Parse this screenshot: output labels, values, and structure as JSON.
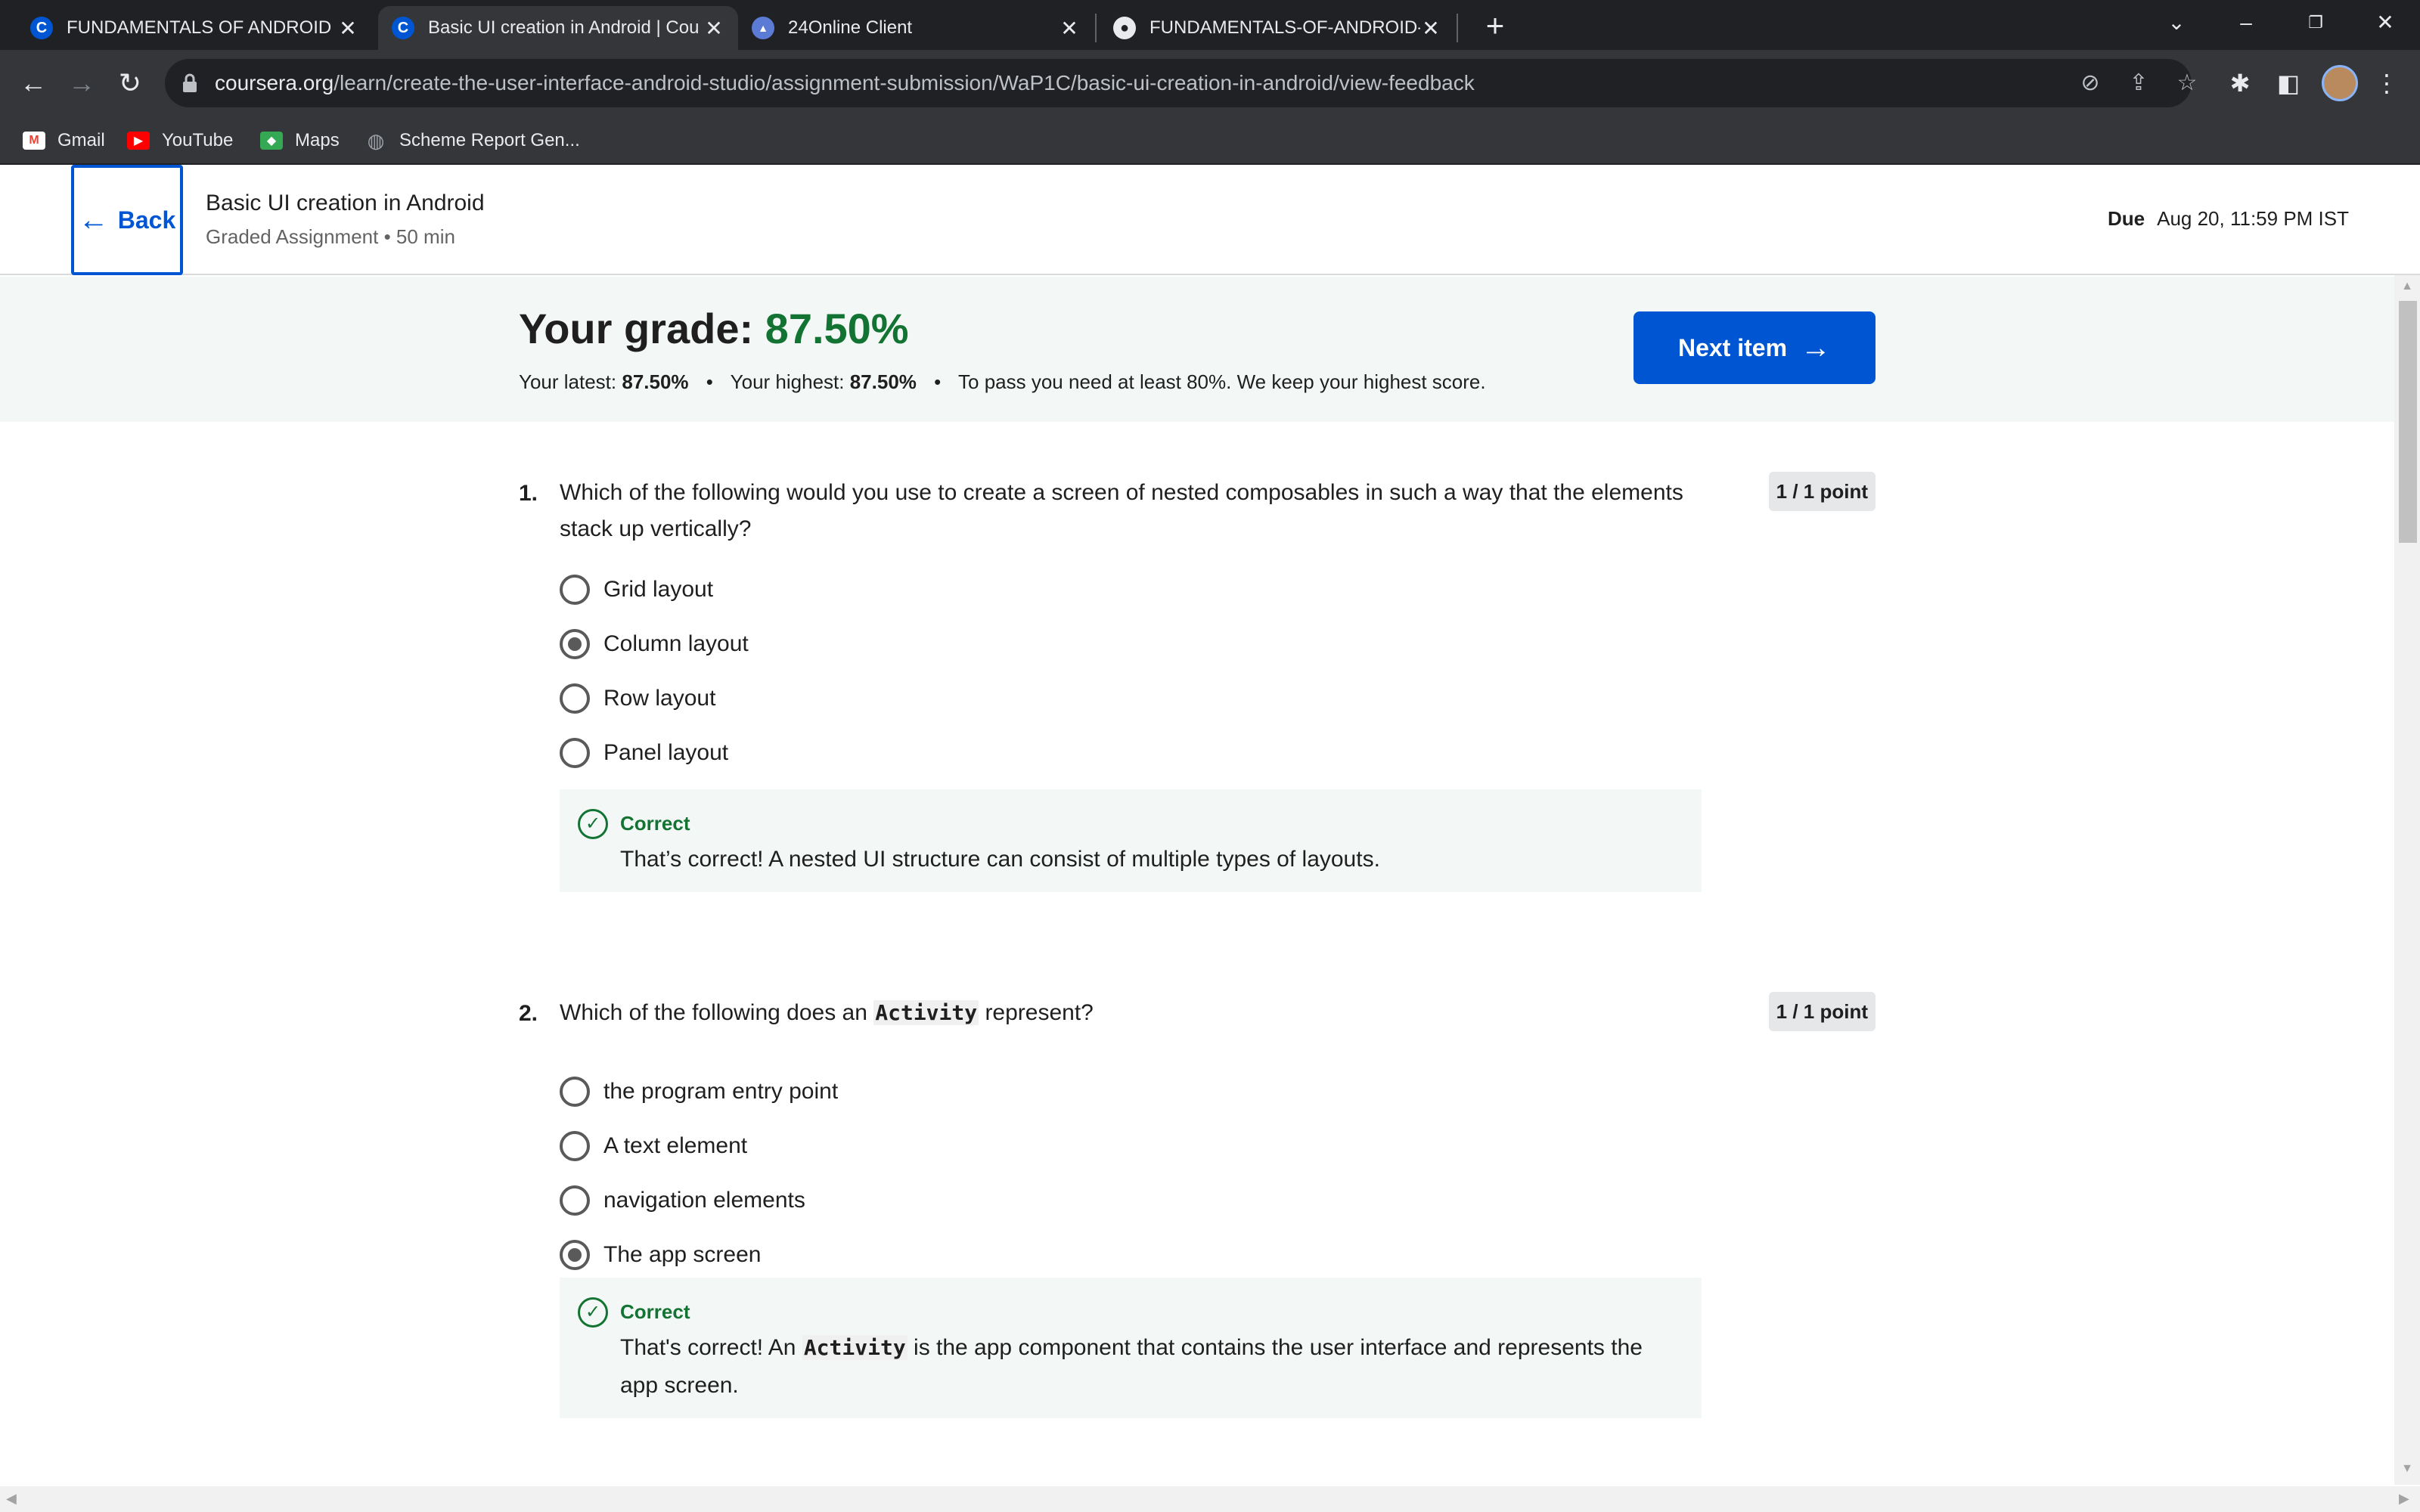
{
  "browser": {
    "tabs": [
      {
        "title": "FUNDAMENTALS OF ANDROID ::",
        "close": "✕"
      },
      {
        "title": "Basic UI creation in Android | Cou",
        "close": "✕"
      },
      {
        "title": "24Online Client",
        "close": "✕"
      },
      {
        "title": "FUNDAMENTALS-OF-ANDROID-",
        "close": "✕"
      }
    ],
    "url_host": "coursera.org",
    "url_path": "/learn/create-the-user-interface-android-studio/assignment-submission/WaP1C/basic-ui-creation-in-android/view-feedback",
    "bookmarks": [
      {
        "label": "Gmail",
        "icon": "gmail-icon",
        "color": "#ea4335"
      },
      {
        "label": "YouTube",
        "icon": "youtube-icon",
        "color": "#ff0000"
      },
      {
        "label": "Maps",
        "icon": "maps-icon",
        "color": "#34a853"
      },
      {
        "label": "Scheme Report Gen...",
        "icon": "globe-icon",
        "color": "#9aa0a6"
      }
    ]
  },
  "header": {
    "back_label": "Back",
    "title": "Basic UI creation in Android",
    "meta": "Graded Assignment • 50 min",
    "due_label": "Due",
    "due_value": "Aug 20, 11:59 PM IST"
  },
  "grade": {
    "label": "Your grade:",
    "value": "87.50%",
    "latest_label": "Your latest:",
    "latest_value": "87.50%",
    "highest_label": "Your highest:",
    "highest_value": "87.50%",
    "dot": "•",
    "pass_note": "To pass you need at least 80%. We keep your highest score.",
    "next_label": "Next item",
    "accent": "#137333",
    "button_color": "#0056d2"
  },
  "questions": [
    {
      "number": "1.",
      "text": "Which of the following would you use to create a screen of nested composables in such a way that the elements stack up vertically?",
      "points": "1 / 1 point",
      "options": [
        "Grid layout",
        "Column layout",
        "Row layout",
        "Panel layout"
      ],
      "selected_index": 1,
      "feedback_label": "Correct",
      "feedback_text": "That’s correct! A nested UI structure can consist of multiple types of layouts."
    },
    {
      "number": "2.",
      "text_before": "Which of the following does an ",
      "code": "Activity",
      "text_after": " represent?",
      "points": "1 / 1 point",
      "options": [
        "the program entry point",
        "A text element",
        "navigation elements",
        "The app screen"
      ],
      "selected_index": 3,
      "feedback_label": "Correct",
      "feedback_before": "That's correct! An ",
      "feedback_code": "Activity",
      "feedback_after": " is the app component that contains the user interface and represents the app screen."
    }
  ]
}
